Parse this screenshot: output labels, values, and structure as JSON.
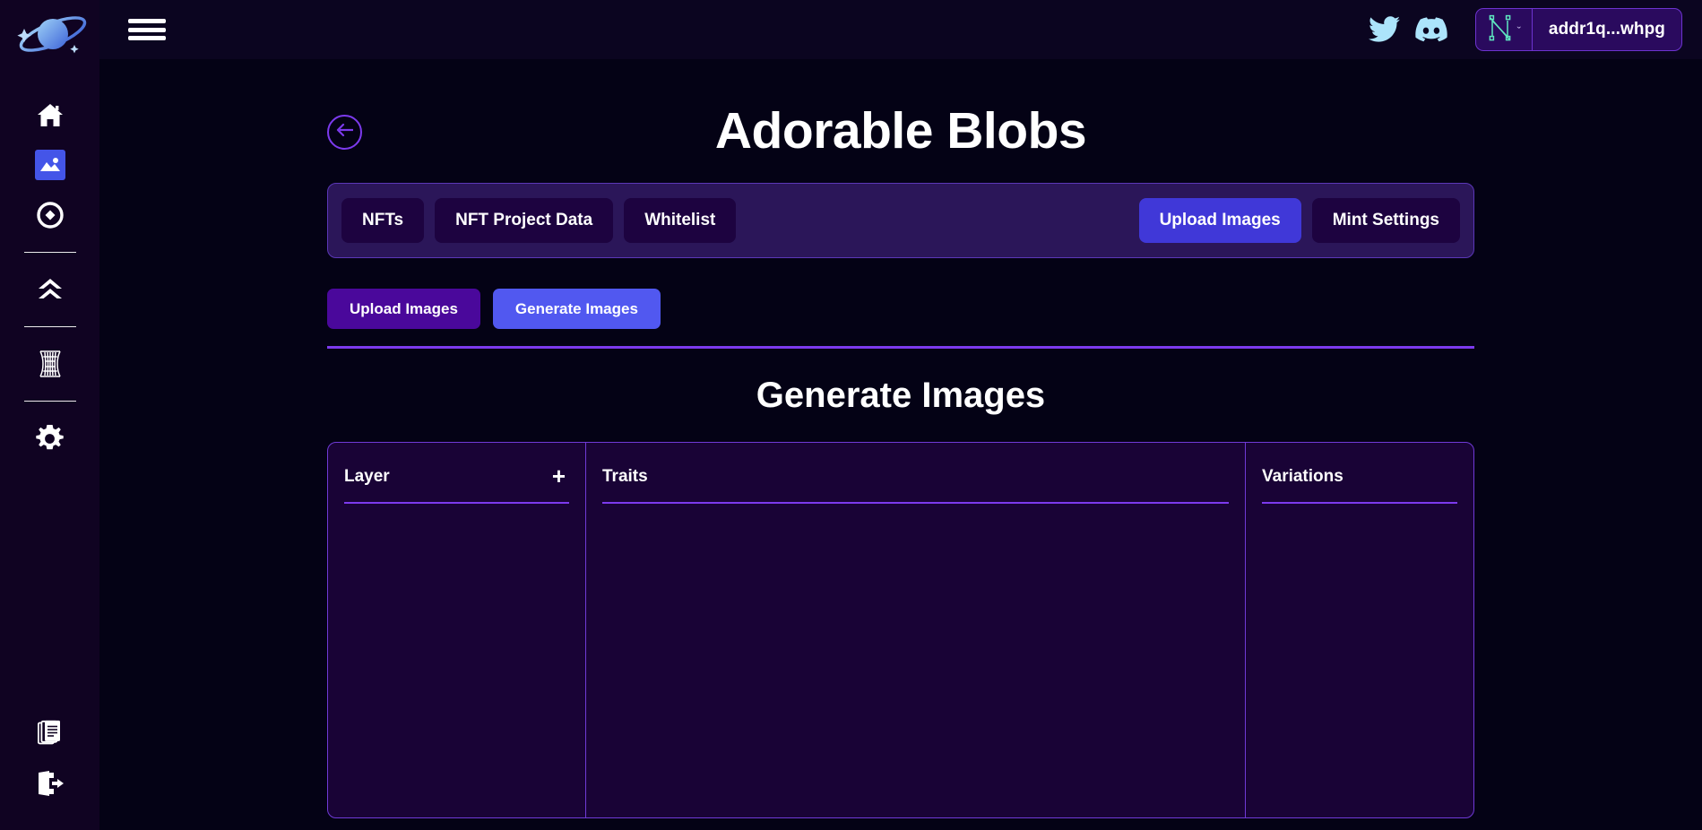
{
  "sidebar": {
    "logo": {
      "name": "planet-logo",
      "label": "Planet Logo"
    },
    "items": [
      {
        "id": "home",
        "icon": "home-icon",
        "label": "Home",
        "active": false
      },
      {
        "id": "gallery",
        "icon": "image-icon",
        "label": "Gallery",
        "active": true
      },
      {
        "id": "explore",
        "icon": "compass-icon",
        "label": "Explore",
        "active": false
      },
      {
        "id": "stake",
        "icon": "chevrons-up-icon",
        "label": "Stake",
        "active": false
      },
      {
        "id": "portal",
        "icon": "wormhole-icon",
        "label": "Portal",
        "active": false
      },
      {
        "id": "settings",
        "icon": "gear-icon",
        "label": "Settings",
        "active": false
      }
    ],
    "bottom_items": [
      {
        "id": "documents",
        "icon": "documents-icon",
        "label": "Documents"
      },
      {
        "id": "logout",
        "icon": "logout-icon",
        "label": "Log Out"
      }
    ]
  },
  "topbar": {
    "menu_icon": "hamburger-menu-icon",
    "twitter_icon": "twitter-icon",
    "discord_icon": "discord-icon",
    "wallet": {
      "provider_icon": "nami-wallet-icon",
      "chevron": "ˇ",
      "address": "addr1q...whpg"
    }
  },
  "page": {
    "back_icon": "arrow-left-icon",
    "title": "Adorable Blobs"
  },
  "tabbar": {
    "left_tabs": [
      {
        "id": "nfts",
        "label": "NFTs",
        "active": false
      },
      {
        "id": "project-data",
        "label": "NFT Project Data",
        "active": false
      },
      {
        "id": "whitelist",
        "label": "Whitelist",
        "active": false
      }
    ],
    "right_tabs": [
      {
        "id": "upload-images",
        "label": "Upload Images",
        "active": true
      },
      {
        "id": "mint-settings",
        "label": "Mint Settings",
        "active": false
      }
    ]
  },
  "subtabs": [
    {
      "id": "upload-images",
      "label": "Upload Images",
      "active": false
    },
    {
      "id": "generate-images",
      "label": "Generate Images",
      "active": true
    }
  ],
  "section": {
    "heading": "Generate Images"
  },
  "columns": {
    "layer": {
      "title": "Layer",
      "add_label": "+",
      "rows": []
    },
    "traits": {
      "title": "Traits",
      "rows": []
    },
    "variations": {
      "title": "Variations",
      "rows": []
    }
  },
  "colors": {
    "sidebar_bg": "#100322",
    "main_bg": "#040215",
    "topbar_bg": "#0b0520",
    "panel_bg": "#190336",
    "panel_border": "#6f3ad6",
    "tabbar_bg": "#2b1659",
    "tab_bg": "#1d0340",
    "accent_primary": "#4038d8",
    "accent_generate": "#5158f0",
    "accent_upload": "#4a089b",
    "divider": "#7c3aed",
    "wallet_bg": "#2a0a5e",
    "social_icon": "#ace4fb"
  }
}
